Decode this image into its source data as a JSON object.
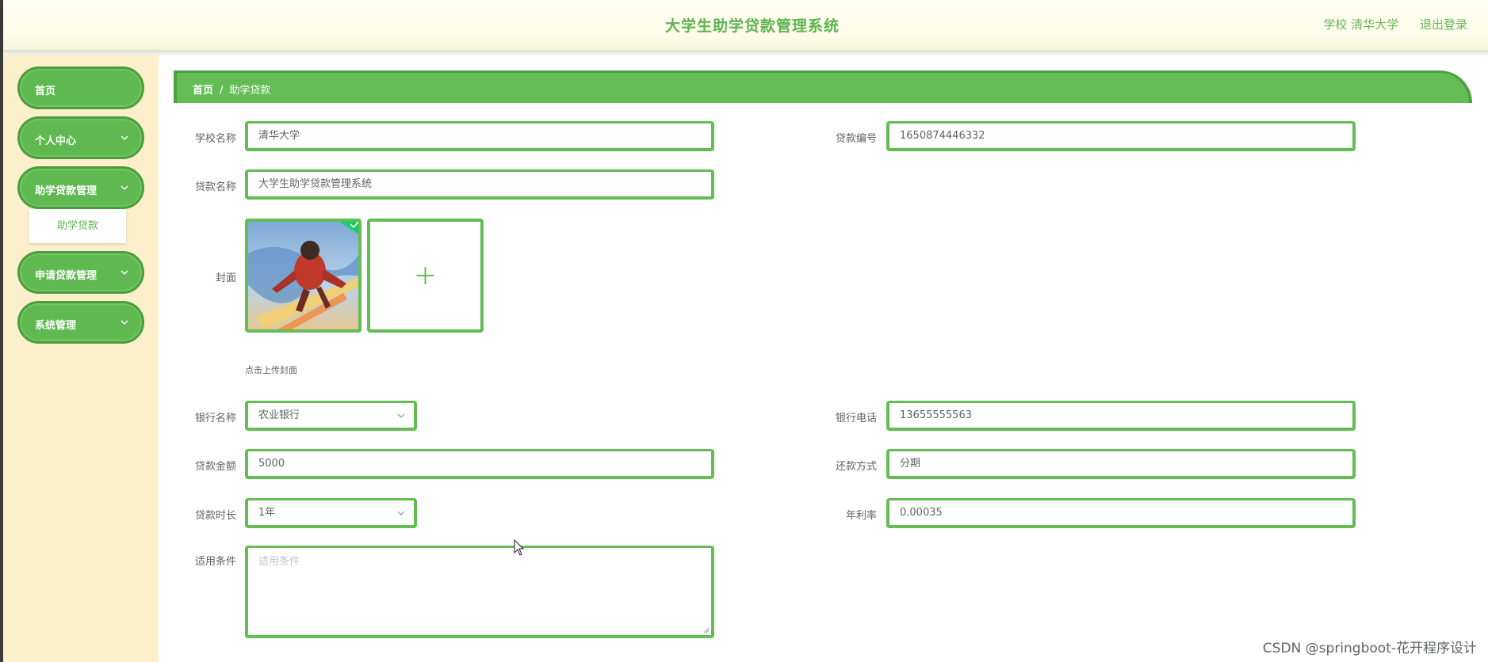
{
  "header": {
    "title": "大学生助学贷款管理系统",
    "user_text": "学校 清华大学",
    "logout_label": "退出登录"
  },
  "sidebar": {
    "items": [
      {
        "label": "首页"
      },
      {
        "label": "个人中心"
      },
      {
        "label": "助学贷款管理"
      },
      {
        "label": "申请贷款管理"
      },
      {
        "label": "系统管理"
      }
    ],
    "submenu": {
      "label": "助学贷款"
    }
  },
  "breadcrumb": {
    "home": "首页",
    "separator": "/",
    "current": "助学贷款"
  },
  "form": {
    "school_name": {
      "label": "学校名称",
      "value": "清华大学"
    },
    "loan_no": {
      "label": "贷款编号",
      "value": "1650874446332"
    },
    "loan_name": {
      "label": "贷款名称",
      "value": "大学生助学贷款管理系统"
    },
    "cover": {
      "label": "封面",
      "tip": "点击上传封面"
    },
    "bank_name": {
      "label": "银行名称",
      "value": "农业银行"
    },
    "bank_phone": {
      "label": "银行电话",
      "value": "13655555563"
    },
    "loan_amount": {
      "label": "贷款金额",
      "value": "5000"
    },
    "repay_method": {
      "label": "还款方式",
      "value": "分期"
    },
    "loan_duration": {
      "label": "贷款时长",
      "value": "1年"
    },
    "annual_rate": {
      "label": "年利率",
      "value": "0.00035"
    },
    "conditions": {
      "label": "适用条件",
      "placeholder": "适用条件"
    }
  },
  "watermark": "CSDN @springboot-花开程序设计",
  "colors": {
    "accent": "#63bd54",
    "accent_dark": "#4d9f42",
    "sidebar_bg": "#feefcc",
    "header_bg": "#fdfde9"
  }
}
